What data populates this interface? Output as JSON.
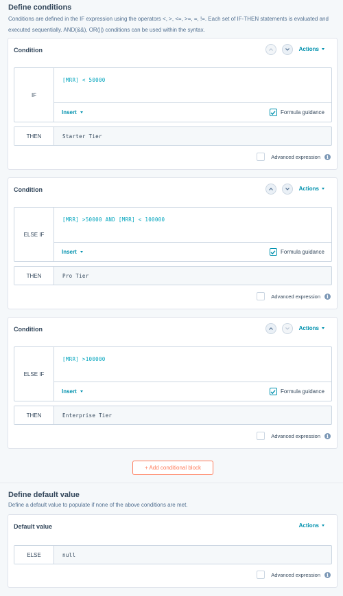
{
  "header": {
    "title": "Define conditions",
    "description": "Conditions are defined in the IF expression using the operators <, >, <=, >=, =, !=. Each set of IF-THEN statements is evaluated and executed sequentially. AND(&&), OR(||) conditions can be used within the syntax."
  },
  "common": {
    "condition_title": "Condition",
    "actions_label": "Actions",
    "insert_label": "Insert",
    "formula_guidance_label": "Formula guidance",
    "then_label": "THEN",
    "advanced_label": "Advanced expression"
  },
  "blocks": [
    {
      "keyword": "IF",
      "expression": "[MRR] < 50000",
      "then_value": "Starter Tier",
      "formula_guidance_checked": true,
      "advanced_checked": false
    },
    {
      "keyword": "ELSE IF",
      "expression": "[MRR] >50000 AND [MRR] < 100000",
      "then_value": "Pro Tier",
      "formula_guidance_checked": true,
      "advanced_checked": false
    },
    {
      "keyword": "ELSE IF",
      "expression": "[MRR] >100000",
      "then_value": "Enterprise Tier",
      "formula_guidance_checked": true,
      "advanced_checked": false
    }
  ],
  "add_block_label": "+ Add conditional block",
  "default_section": {
    "title": "Define default value",
    "description": "Define a default value to populate if none of the above conditions are met.",
    "card_title": "Default value",
    "else_label": "ELSE",
    "else_value": "null",
    "advanced_checked": false
  },
  "colors": {
    "accent": "#0091ae",
    "expression": "#00a4bd",
    "add_button": "#ff7a59"
  }
}
